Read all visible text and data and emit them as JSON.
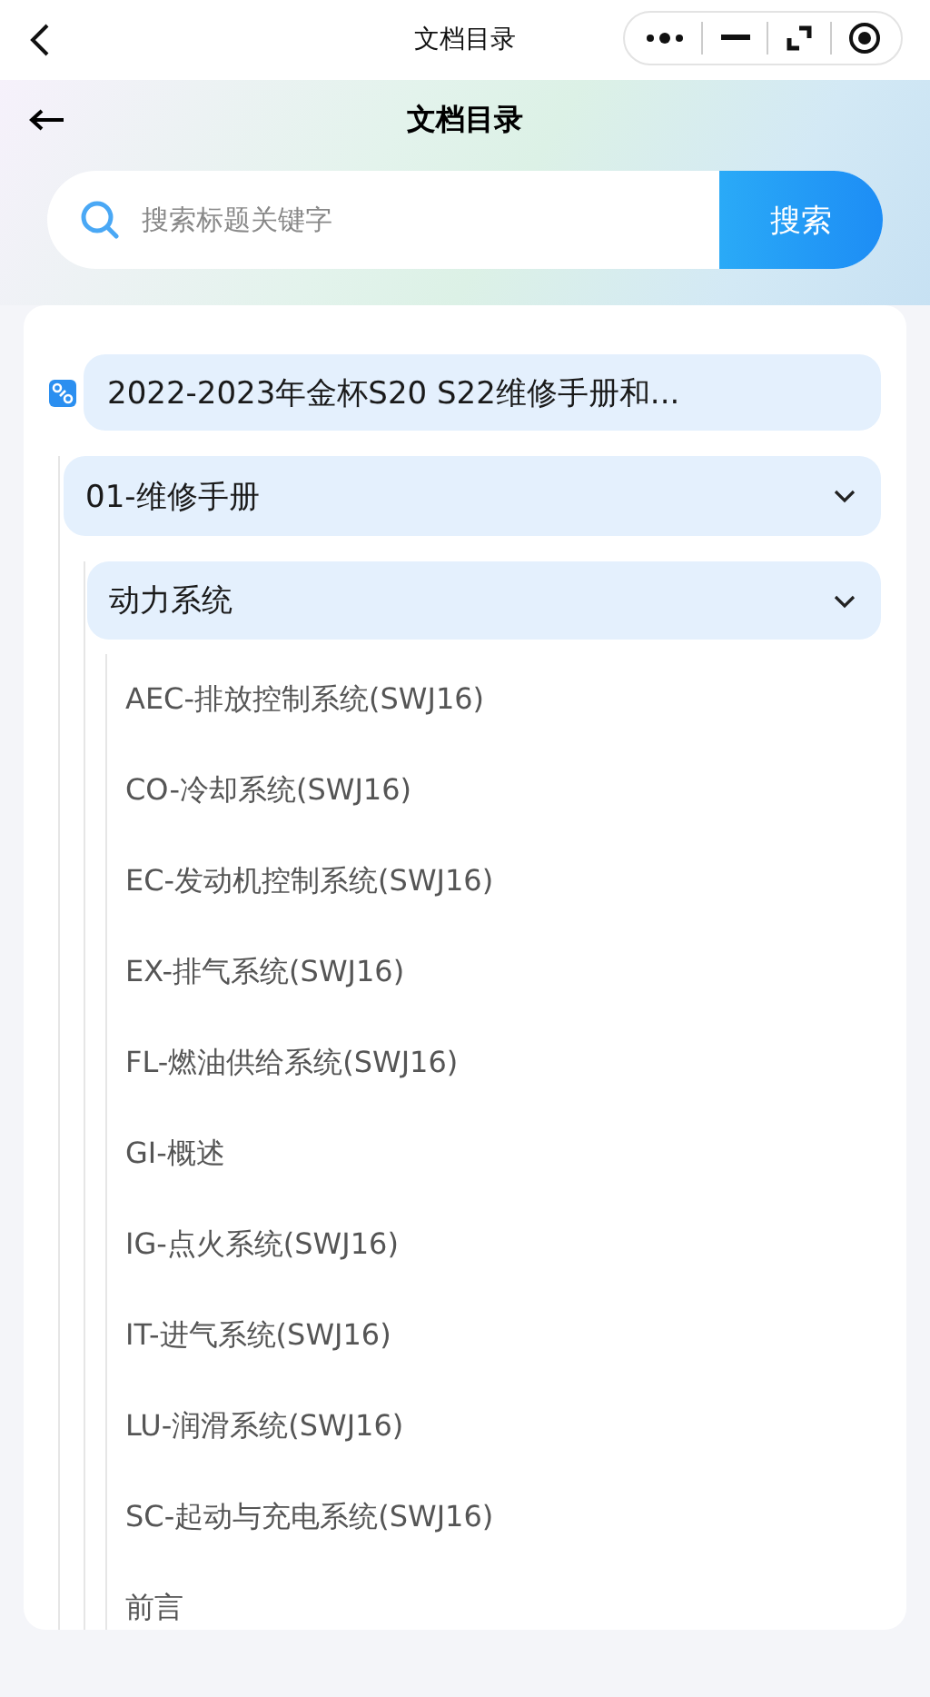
{
  "capsule_bar": {
    "title": "文档目录"
  },
  "header": {
    "title": "文档目录"
  },
  "search": {
    "placeholder": "搜索标题关键字",
    "button": "搜索"
  },
  "tree": {
    "label": "2022-2023年金杯S20 S22维修手册和...",
    "children": [
      {
        "label": "01-维修手册",
        "expanded": true,
        "children": [
          {
            "label": "动力系统",
            "expanded": true,
            "children": [
              {
                "label": "AEC-排放控制系统(SWJ16)"
              },
              {
                "label": "CO-冷却系统(SWJ16)"
              },
              {
                "label": "EC-发动机控制系统(SWJ16)"
              },
              {
                "label": "EX-排气系统(SWJ16)"
              },
              {
                "label": "FL-燃油供给系统(SWJ16)"
              },
              {
                "label": "GI-概述"
              },
              {
                "label": "IG-点火系统(SWJ16)"
              },
              {
                "label": "IT-进气系统(SWJ16)"
              },
              {
                "label": "LU-润滑系统(SWJ16)"
              },
              {
                "label": "SC-起动与充电系统(SWJ16)"
              },
              {
                "label": "前言"
              }
            ]
          }
        ]
      }
    ]
  }
}
